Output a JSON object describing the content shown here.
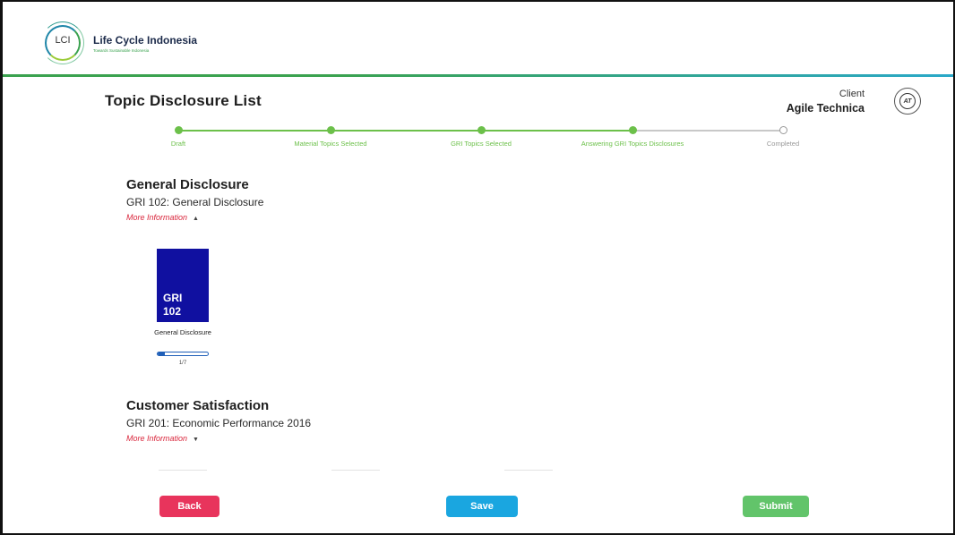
{
  "brand": {
    "abbr": "LCI",
    "name": "Life Cycle Indonesia",
    "tagline": "Towards Sustainable Indonesia",
    "logo_colors": [
      "#1f86a8",
      "#3aa24f",
      "#9ccc3a"
    ]
  },
  "header": {
    "title": "Topic Disclosure List",
    "client_label": "Client",
    "client_name": "Agile Technica",
    "client_seal_text": "AT"
  },
  "stepper": {
    "steps": [
      {
        "label": "Draft",
        "done": true
      },
      {
        "label": "Material Topics Selected",
        "done": true
      },
      {
        "label": "GRI Topics Selected",
        "done": true
      },
      {
        "label": "Answering GRI Topics Disclosures",
        "done": true
      },
      {
        "label": "Completed",
        "done": false
      }
    ],
    "active_color": "#6cc04a"
  },
  "sections": [
    {
      "title": "General Disclosure",
      "subtitle": "GRI 102: General Disclosure",
      "more_info": "More Information",
      "expanded": true,
      "cards": [
        {
          "line1": "GRI",
          "line2": "102",
          "caption": "General Disclosure",
          "progress": {
            "done": 1,
            "total": 7,
            "label": "1/7"
          },
          "color": "#1010a0"
        }
      ]
    },
    {
      "title": "Customer Satisfaction",
      "subtitle": "GRI 201: Economic Performance 2016",
      "more_info": "More Information",
      "expanded": false
    }
  ],
  "actions": {
    "back": "Back",
    "save": "Save",
    "submit": "Submit"
  }
}
